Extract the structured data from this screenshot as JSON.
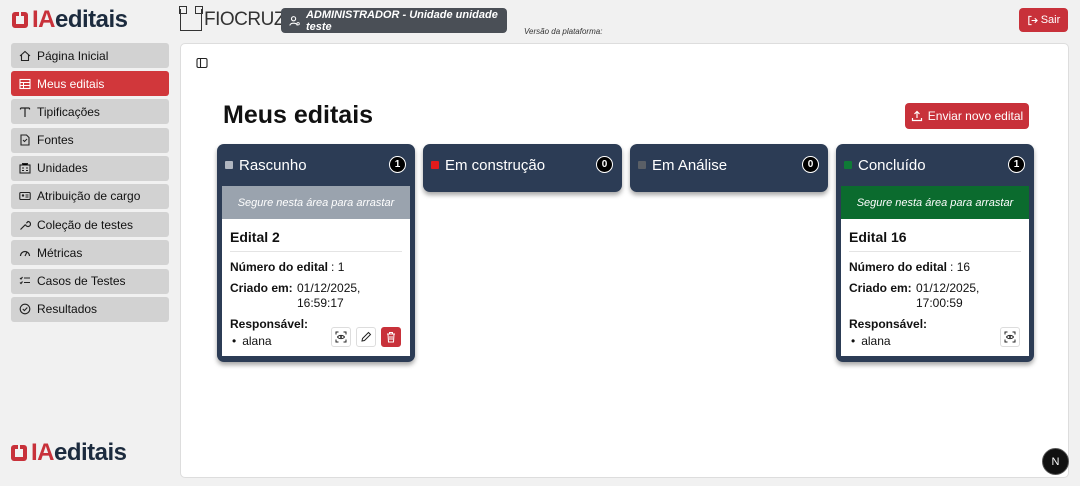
{
  "brand": {
    "logo_ia": "IA",
    "logo_rest": "editais",
    "partner": "FIOCRUZ"
  },
  "header": {
    "user_badge": "ADMINISTRADOR - Unidade unidade teste",
    "version_label": "Versão da plataforma:",
    "logout_label": "Sair"
  },
  "sidebar": {
    "items": [
      {
        "label": "Página Inicial",
        "icon": "home-icon"
      },
      {
        "label": "Meus editais",
        "icon": "table-icon",
        "active": true
      },
      {
        "label": "Tipificações",
        "icon": "type-icon"
      },
      {
        "label": "Fontes",
        "icon": "file-icon"
      },
      {
        "label": "Unidades",
        "icon": "building-icon"
      },
      {
        "label": "Atribuição de cargo",
        "icon": "id-card-icon"
      },
      {
        "label": "Coleção de testes",
        "icon": "wrench-icon"
      },
      {
        "label": "Métricas",
        "icon": "gauge-icon"
      },
      {
        "label": "Casos de Testes",
        "icon": "list-check-icon"
      },
      {
        "label": "Resultados",
        "icon": "check-circle-icon"
      }
    ]
  },
  "main": {
    "title": "Meus editais",
    "upload_button": "Enviar novo edital",
    "drag_hint": "Segure nesta área para arrastar",
    "columns": [
      {
        "title": "Rascunho",
        "count": "1",
        "dot_color": "#b0b6c0",
        "drag_bg": "#9aa3ae",
        "cards": [
          {
            "title": "Edital 2",
            "numero_label": "Número do edital",
            "numero": "1",
            "criado_label": "Criado em:",
            "criado_date": "01/12/2025,",
            "criado_time": "16:59:17",
            "responsavel_label": "Responsável:",
            "responsavel": "alana"
          }
        ]
      },
      {
        "title": "Em construção",
        "count": "0",
        "dot_color": "#e01b1b",
        "cards": []
      },
      {
        "title": "Em Análise",
        "count": "0",
        "dot_color": "#5a5f66",
        "cards": []
      },
      {
        "title": "Concluído",
        "count": "1",
        "dot_color": "#0f7a36",
        "drag_bg": "#0b6b2e",
        "cards": [
          {
            "title": "Edital 16",
            "numero_label": "Número do edital",
            "numero": "16",
            "criado_label": "Criado em:",
            "criado_date": "01/12/2025,",
            "criado_time": "17:00:59",
            "responsavel_label": "Responsável:",
            "responsavel": "alana"
          }
        ]
      }
    ]
  },
  "floating_badge": "N",
  "colors": {
    "accent": "#c8313a",
    "column_bg": "#2c3c55"
  }
}
